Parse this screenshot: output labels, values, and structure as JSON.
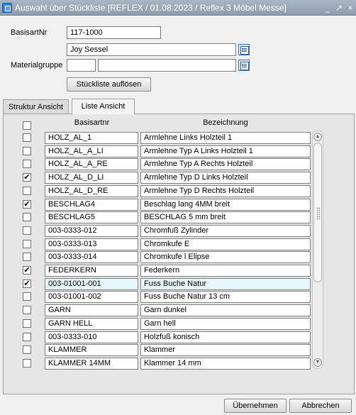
{
  "window": {
    "title": "Auswahl über Stückliste  [REFLEX / 01.08.2023 / Reflex 3 Möbel Messe]",
    "controls": [
      "_",
      "↗",
      "×"
    ]
  },
  "form": {
    "basisartnr_label": "BasisartNr",
    "basisartnr_value": "117-1000",
    "description_value": "Joy Sessel",
    "materialgruppe_label": "Materialgruppe",
    "materialgruppe_code": "",
    "materialgruppe_name": "",
    "resolve_button": "Stückliste auflösen"
  },
  "tabs": [
    {
      "label": "Struktur Ansicht",
      "active": false
    },
    {
      "label": "Liste Ansicht",
      "active": true
    }
  ],
  "grid": {
    "columns": [
      "Basisartnr",
      "Bezeichnung"
    ],
    "rows": [
      {
        "checked": false,
        "basisartnr": "HOLZ_AL_1",
        "bezeichnung": "Armlehne Links Holzteil 1"
      },
      {
        "checked": false,
        "basisartnr": "HOLZ_AL_A_LI",
        "bezeichnung": "Armlehne Typ A Links Holzteil 1"
      },
      {
        "checked": false,
        "basisartnr": "HOLZ_AL_A_RE",
        "bezeichnung": "Armlehne Typ A Rechts Holzteil"
      },
      {
        "checked": true,
        "basisartnr": "HOLZ_AL_D_LI",
        "bezeichnung": "Armlehne Typ D Links Holzteil"
      },
      {
        "checked": false,
        "basisartnr": "HOLZ_AL_D_RE",
        "bezeichnung": "Armlehne Typ D Rechts Holzteil"
      },
      {
        "checked": true,
        "basisartnr": "BESCHLAG4",
        "bezeichnung": "Beschlag lang 4MM breit"
      },
      {
        "checked": false,
        "basisartnr": "BESCHLAG5",
        "bezeichnung": "BESCHLAG 5 mm breit"
      },
      {
        "checked": false,
        "basisartnr": "003-0333-012",
        "bezeichnung": "Chromfuß Zylinder"
      },
      {
        "checked": false,
        "basisartnr": "003-0333-013",
        "bezeichnung": "Chromkufe E"
      },
      {
        "checked": false,
        "basisartnr": "003-0333-014",
        "bezeichnung": "Chromkufe l Elipse"
      },
      {
        "checked": true,
        "basisartnr": "FEDERKERN",
        "bezeichnung": "Federkern"
      },
      {
        "checked": true,
        "basisartnr": "003-01001-001",
        "bezeichnung": "Fuss Buche Natur",
        "selected": true
      },
      {
        "checked": false,
        "basisartnr": "003-01001-002",
        "bezeichnung": "Fuss Buche Natur 13 cm"
      },
      {
        "checked": false,
        "basisartnr": "GARN",
        "bezeichnung": "Garn dunkel"
      },
      {
        "checked": false,
        "basisartnr": "GARN HELL",
        "bezeichnung": "Garn hell"
      },
      {
        "checked": false,
        "basisartnr": "003-0333-010",
        "bezeichnung": "Holzfuß konisch"
      },
      {
        "checked": false,
        "basisartnr": "KLAMMER",
        "bezeichnung": "Klammer"
      },
      {
        "checked": false,
        "basisartnr": "KLAMMER 14MM",
        "bezeichnung": "Klammer 14 mm"
      }
    ]
  },
  "footer": {
    "apply_button": "Übernehmen",
    "cancel_button": "Abbrechen"
  },
  "colors": {
    "titlebar": "#98a6b6",
    "selected_row": "#e6f8fb"
  }
}
